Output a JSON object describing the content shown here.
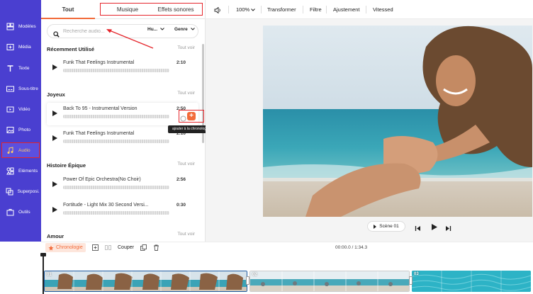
{
  "nav": {
    "items": [
      {
        "label": "Modèles",
        "icon": "templates-icon"
      },
      {
        "label": "Média",
        "icon": "media-icon"
      },
      {
        "label": "Texte",
        "icon": "text-icon"
      },
      {
        "label": "Sous-titre",
        "icon": "subtitle-icon"
      },
      {
        "label": "Vidéo",
        "icon": "video-icon"
      },
      {
        "label": "Photo",
        "icon": "photo-icon"
      },
      {
        "label": "Audio",
        "icon": "music-note-icon",
        "active": true
      },
      {
        "label": "Éléments",
        "icon": "elements-icon"
      },
      {
        "label": "Superposi...",
        "icon": "overlay-icon"
      },
      {
        "label": "Outils",
        "icon": "tools-icon"
      }
    ]
  },
  "panel": {
    "tabs": [
      "Tout",
      "Musique",
      "Effets sonores"
    ],
    "search": {
      "placeholder": "Recherche audio...",
      "mood": "Hu...",
      "genre": "Genre"
    },
    "see_all": "Tout voir",
    "sections": [
      {
        "title": "Récemment Utilisé",
        "tracks": [
          {
            "name": "Funk That Feelings Instrumental",
            "duration": "2:10"
          }
        ]
      },
      {
        "title": "Joyeux",
        "tracks": [
          {
            "name": "Back To 95 - Instrumental Version",
            "duration": "2:50"
          },
          {
            "name": "Funk That Feelings Instrumental",
            "duration": "2:10"
          }
        ]
      },
      {
        "title": "Histoire Épique",
        "tracks": [
          {
            "name": "Power Of Epic Orchestra(No Choir)",
            "duration": "2:56"
          },
          {
            "name": "Fortitude - Light Mix 30 Second Versi...",
            "duration": "0:30"
          }
        ]
      },
      {
        "title": "Amour",
        "tracks": []
      }
    ],
    "add_button": "+",
    "tooltip": "ajouter à la chronologie"
  },
  "toolbar": {
    "zoom": "100%",
    "transform": "Transformer",
    "filter": "Filtre",
    "adjust": "Ajustement",
    "speed": "Vitessed"
  },
  "player": {
    "scene": "Scène 01"
  },
  "timeline": {
    "chrono": "Chronologie",
    "cut": "Couper",
    "time": "00:00.0 / 1:34.3",
    "clips": [
      "01",
      "02",
      "03"
    ]
  },
  "colors": {
    "nav_bg": "#4a3fd0",
    "accent": "#f26b3a",
    "highlight": "#e5262c"
  }
}
